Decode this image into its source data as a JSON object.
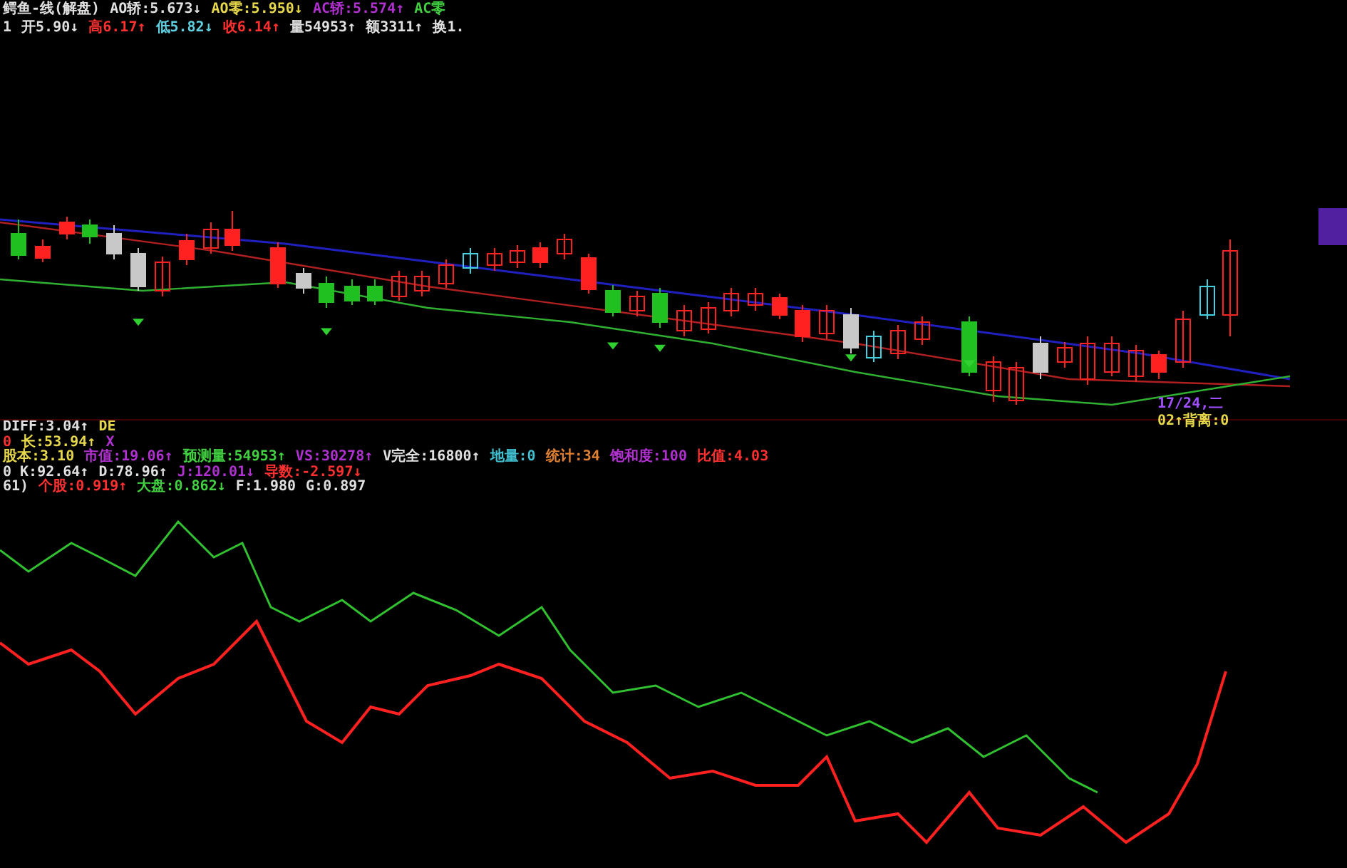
{
  "header_lines": [
    {
      "segments": [
        {
          "text": "鳄鱼-线(解盘)",
          "color": "#e0e0e0"
        },
        {
          "text": "AO轿:5.673↓",
          "color": "#e0e0e0"
        },
        {
          "text": "AO零:5.950↓",
          "color": "#e6d84a"
        },
        {
          "text": "AC轿:5.574↑",
          "color": "#b030d0"
        },
        {
          "text": "AC零",
          "color": "#40d040"
        }
      ]
    },
    {
      "segments": [
        {
          "text": "1",
          "color": "#e0e0e0"
        },
        {
          "text": "开5.90↓",
          "color": "#e0e0e0"
        },
        {
          "text": "高6.17↑",
          "color": "#ff3030"
        },
        {
          "text": "低5.82↓",
          "color": "#60d0e0"
        },
        {
          "text": "收6.14↑",
          "color": "#ff3030"
        },
        {
          "text": "量54953↑",
          "color": "#e0e0e0"
        },
        {
          "text": "额3311↑",
          "color": "#e0e0e0"
        },
        {
          "text": "换1.",
          "color": "#e0e0e0"
        }
      ]
    }
  ],
  "chart_labels": [
    {
      "text": "17/24,二",
      "color": "#a050ff"
    },
    {
      "text": "02↑背离:0",
      "color": "#e6d84a"
    }
  ],
  "indicator_lines": [
    {
      "segments": [
        {
          "text": "DIFF:3.04↑",
          "color": "#e0e0e0"
        },
        {
          "text": "DE",
          "color": "#e6d84a"
        }
      ]
    },
    {
      "segments": [
        {
          "text": "0",
          "color": "#ff3030"
        },
        {
          "text": "长:53.94↑",
          "color": "#e6d84a"
        },
        {
          "text": "X",
          "color": "#b030d0"
        }
      ]
    },
    {
      "segments": [
        {
          "text": "股本:3.10",
          "color": "#e6d84a"
        },
        {
          "text": "市值:19.06↑",
          "color": "#b030d0"
        },
        {
          "text": "预测量:54953↑",
          "color": "#40d040"
        },
        {
          "text": "VS:30278↑",
          "color": "#b030d0"
        },
        {
          "text": "V完全:16800↑",
          "color": "#e0e0e0"
        },
        {
          "text": "地量:0",
          "color": "#40c0d0"
        },
        {
          "text": "统计:34",
          "color": "#e08030"
        },
        {
          "text": "饱和度:100",
          "color": "#b030d0"
        },
        {
          "text": "比值:4.03",
          "color": "#ff3030"
        }
      ]
    },
    {
      "segments": [
        {
          "text": "0 K:92.64↑",
          "color": "#e0e0e0"
        },
        {
          "text": "D:78.96↑",
          "color": "#e0e0e0"
        },
        {
          "text": "J:120.01↓",
          "color": "#b030d0"
        },
        {
          "text": "导数:-2.597↓",
          "color": "#ff3030"
        }
      ]
    },
    {
      "segments": [
        {
          "text": "61)",
          "color": "#e0e0e0"
        },
        {
          "text": "个股:0.919↑",
          "color": "#ff3030"
        },
        {
          "text": "大盘:0.862↓",
          "color": "#40d040"
        },
        {
          "text": "F:1.980",
          "color": "#e0e0e0"
        },
        {
          "text": "G:0.897",
          "color": "#e0e0e0"
        }
      ]
    }
  ]
}
